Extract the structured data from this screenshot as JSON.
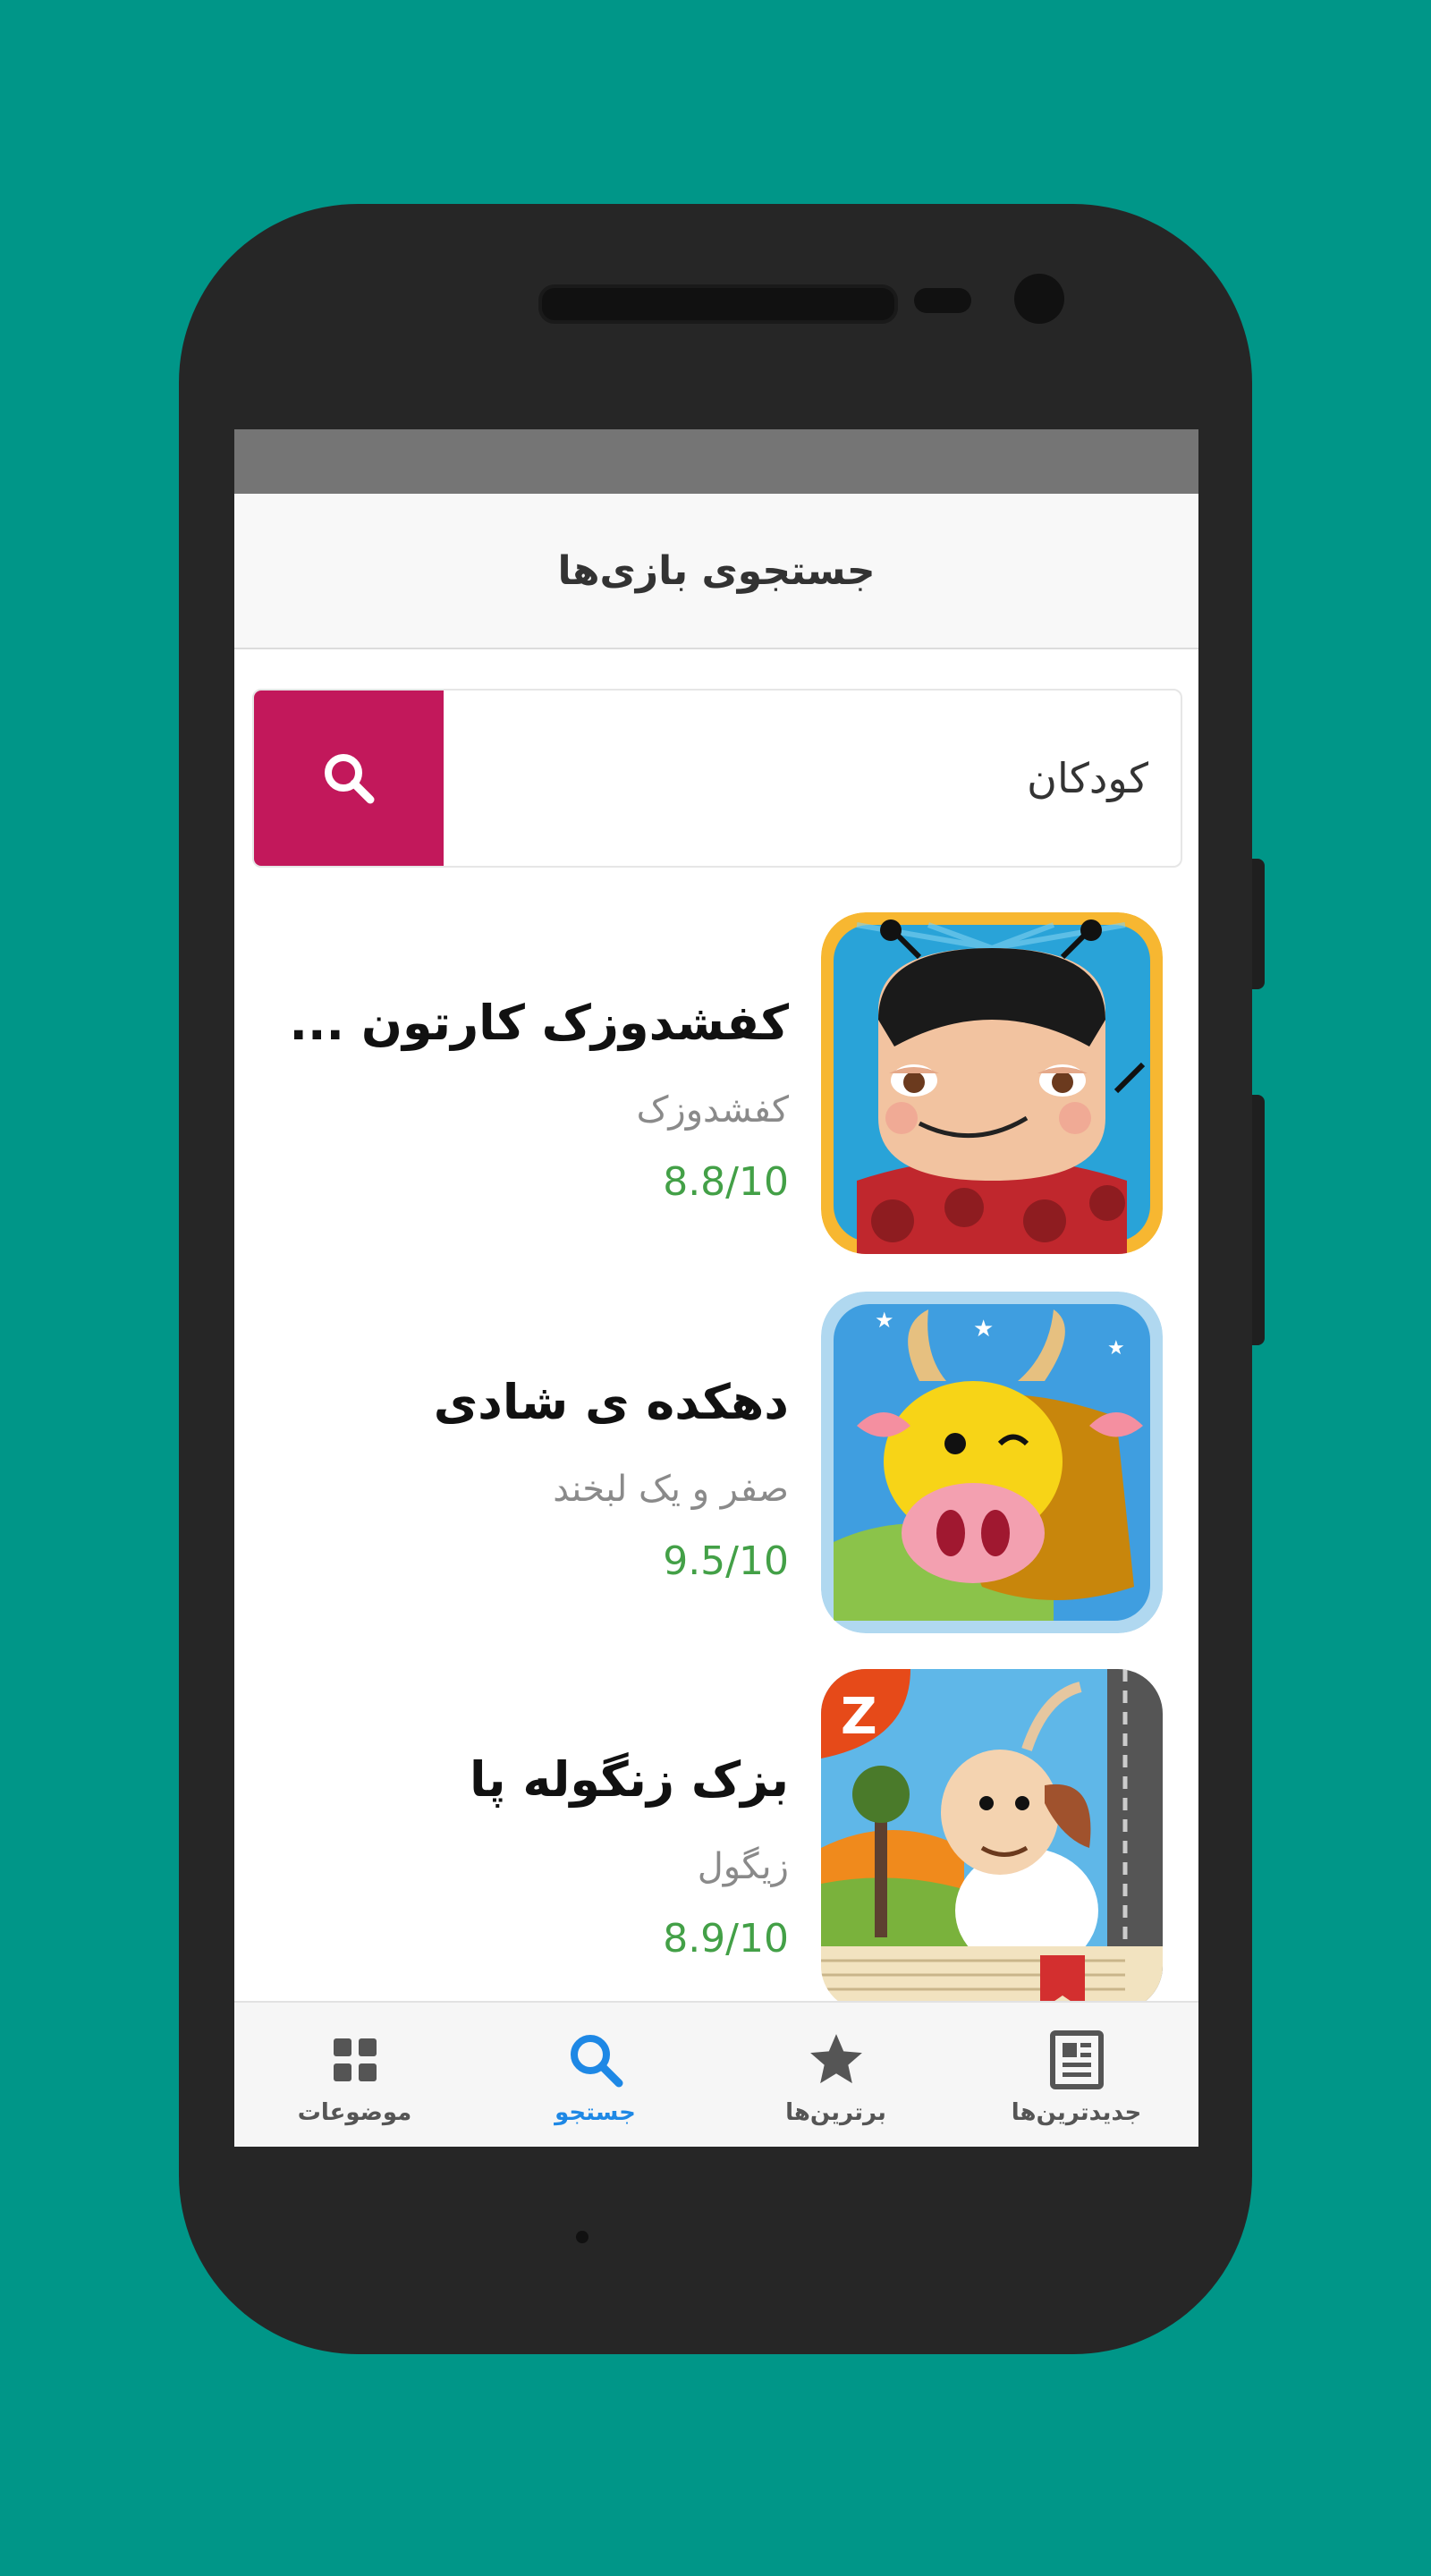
{
  "app": {
    "title": "جستجوی بازی‌ها"
  },
  "search": {
    "value": "کودکان",
    "button_icon": "search-icon"
  },
  "results": [
    {
      "title": "کفشدوزک کارتون ...",
      "developer": "کفشدوزک",
      "rating": "8.8/10",
      "icon": "ladybug-cartoon-app-icon"
    },
    {
      "title": "دهکده ی شادی",
      "developer": "صفر و یک لبخند",
      "rating": "9.5/10",
      "icon": "happy-village-cow-app-icon"
    },
    {
      "title": "بزک زنگوله پا",
      "developer": "زیگول",
      "rating": "8.9/10",
      "icon": "goat-storybook-app-icon"
    }
  ],
  "bottom_nav": [
    {
      "label": "جدیدترین‌ها",
      "icon": "newspaper-icon",
      "active": false
    },
    {
      "label": "برترین‌ها",
      "icon": "star-icon",
      "active": false
    },
    {
      "label": "جستجو",
      "icon": "search-icon",
      "active": true
    },
    {
      "label": "موضوعات",
      "icon": "grid-icon",
      "active": false
    }
  ],
  "colors": {
    "background": "#009688",
    "search_button": "#c2185b",
    "rating": "#43a047",
    "nav_active": "#1e88e5"
  }
}
